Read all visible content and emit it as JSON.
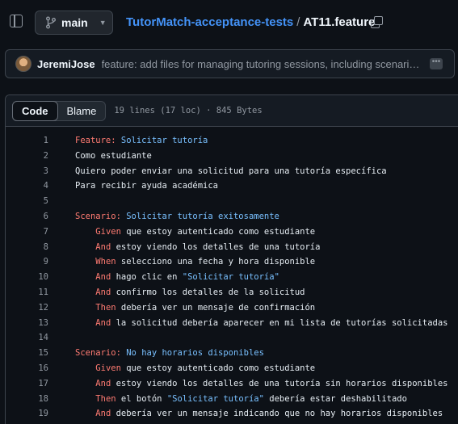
{
  "header": {
    "branch": "main",
    "repo": "TutorMatch-acceptance-tests",
    "separator": "/",
    "file": "AT11.feature"
  },
  "commit": {
    "author": "JeremiJose",
    "message": "feature: add files for managing tutoring sessions, including scenario..."
  },
  "file_view": {
    "tabs": [
      "Code",
      "Blame"
    ],
    "active_tab": "Code",
    "meta": "19 lines (17 loc) · 845 Bytes"
  },
  "code_lines": [
    {
      "n": "1",
      "kw": "Feature:",
      "name": " Solicitar tutoría",
      "rest": "",
      "str": "",
      "tail": "",
      "indent": ""
    },
    {
      "n": "2",
      "kw": "",
      "name": "",
      "rest": "Como estudiante",
      "str": "",
      "tail": "",
      "indent": ""
    },
    {
      "n": "3",
      "kw": "",
      "name": "",
      "rest": "Quiero poder enviar una solicitud para una tutoría específica",
      "str": "",
      "tail": "",
      "indent": ""
    },
    {
      "n": "4",
      "kw": "",
      "name": "",
      "rest": "Para recibir ayuda académica",
      "str": "",
      "tail": "",
      "indent": ""
    },
    {
      "n": "5",
      "kw": "",
      "name": "",
      "rest": "",
      "str": "",
      "tail": "",
      "indent": ""
    },
    {
      "n": "6",
      "kw": "Scenario:",
      "name": " Solicitar tutoría exitosamente",
      "rest": "",
      "str": "",
      "tail": "",
      "indent": ""
    },
    {
      "n": "7",
      "kw": "Given",
      "name": "",
      "rest": " que estoy autenticado como estudiante",
      "str": "",
      "tail": "",
      "indent": "    "
    },
    {
      "n": "8",
      "kw": "And",
      "name": "",
      "rest": " estoy viendo los detalles de una tutoría",
      "str": "",
      "tail": "",
      "indent": "    "
    },
    {
      "n": "9",
      "kw": "When",
      "name": "",
      "rest": " selecciono una fecha y hora disponible",
      "str": "",
      "tail": "",
      "indent": "    "
    },
    {
      "n": "10",
      "kw": "And",
      "name": "",
      "rest": " hago clic en ",
      "str": "\"Solicitar tutoría\"",
      "tail": "",
      "indent": "    "
    },
    {
      "n": "11",
      "kw": "And",
      "name": "",
      "rest": " confirmo los detalles de la solicitud",
      "str": "",
      "tail": "",
      "indent": "    "
    },
    {
      "n": "12",
      "kw": "Then",
      "name": "",
      "rest": " debería ver un mensaje de confirmación",
      "str": "",
      "tail": "",
      "indent": "    "
    },
    {
      "n": "13",
      "kw": "And",
      "name": "",
      "rest": " la solicitud debería aparecer en mi lista de tutorías solicitadas",
      "str": "",
      "tail": "",
      "indent": "    "
    },
    {
      "n": "14",
      "kw": "",
      "name": "",
      "rest": "",
      "str": "",
      "tail": "",
      "indent": ""
    },
    {
      "n": "15",
      "kw": "Scenario:",
      "name": " No hay horarios disponibles",
      "rest": "",
      "str": "",
      "tail": "",
      "indent": ""
    },
    {
      "n": "16",
      "kw": "Given",
      "name": "",
      "rest": " que estoy autenticado como estudiante",
      "str": "",
      "tail": "",
      "indent": "    "
    },
    {
      "n": "17",
      "kw": "And",
      "name": "",
      "rest": " estoy viendo los detalles de una tutoría sin horarios disponibles",
      "str": "",
      "tail": "",
      "indent": "    "
    },
    {
      "n": "18",
      "kw": "Then",
      "name": "",
      "rest": " el botón ",
      "str": "\"Solicitar tutoría\"",
      "tail": " debería estar deshabilitado",
      "indent": "    "
    },
    {
      "n": "19",
      "kw": "And",
      "name": "",
      "rest": " debería ver un mensaje indicando que no hay horarios disponibles",
      "str": "",
      "tail": "",
      "indent": "    "
    }
  ]
}
